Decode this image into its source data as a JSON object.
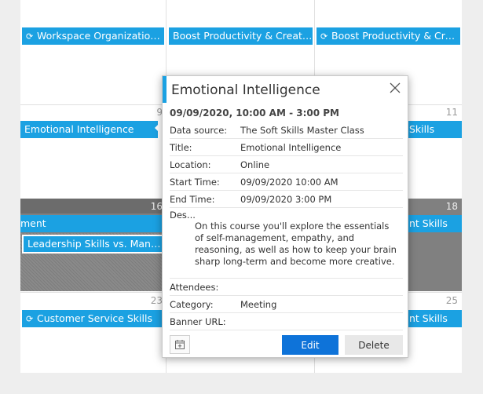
{
  "calendar": {
    "day_numbers": {
      "d9": "9",
      "d11": "11",
      "d16": "16",
      "d18": "18",
      "d23": "23",
      "d25": "25"
    },
    "events": {
      "workspace": "Workspace Organization f...",
      "boost1": "Boost Productivity & Creativit...",
      "boost2": "Boost Productivity & Creati...",
      "emotional": "Emotional Intelligence",
      "skills_w2": "Skills",
      "ment": "ment",
      "skills_w3": "nt Skills",
      "leadership": "Leadership Skills vs. Manage...",
      "customer": "Customer Service Skills",
      "skills_w4": "nt Skills"
    },
    "colors": {
      "event": "#1ba1e2",
      "busy": "#808080"
    }
  },
  "popup": {
    "title": "Emotional Intelligence",
    "when": "09/09/2020, 10:00 AM - 3:00 PM",
    "fields": [
      {
        "label": "Data source:",
        "value": "The Soft Skills Master Class"
      },
      {
        "label": "Title:",
        "value": "Emotional Intelligence"
      },
      {
        "label": "Location:",
        "value": "Online"
      },
      {
        "label": "Start Time:",
        "value": "09/09/2020 10:00 AM"
      },
      {
        "label": "End Time:",
        "value": "09/09/2020 3:00 PM"
      }
    ],
    "description_label": "Des...",
    "description": "On this course you'll explore the essentials of self-management, empathy, and reasoning, as well as how to keep your brain sharp long-term and become more creative.",
    "fields_after": [
      {
        "label": "Attendees:",
        "value": ""
      },
      {
        "label": "Category:",
        "value": "Meeting"
      },
      {
        "label": "Banner URL:",
        "value": ""
      }
    ],
    "edit_label": "Edit",
    "delete_label": "Delete",
    "accent_color": "#1ba1e2",
    "edit_color": "#0e73d9"
  }
}
